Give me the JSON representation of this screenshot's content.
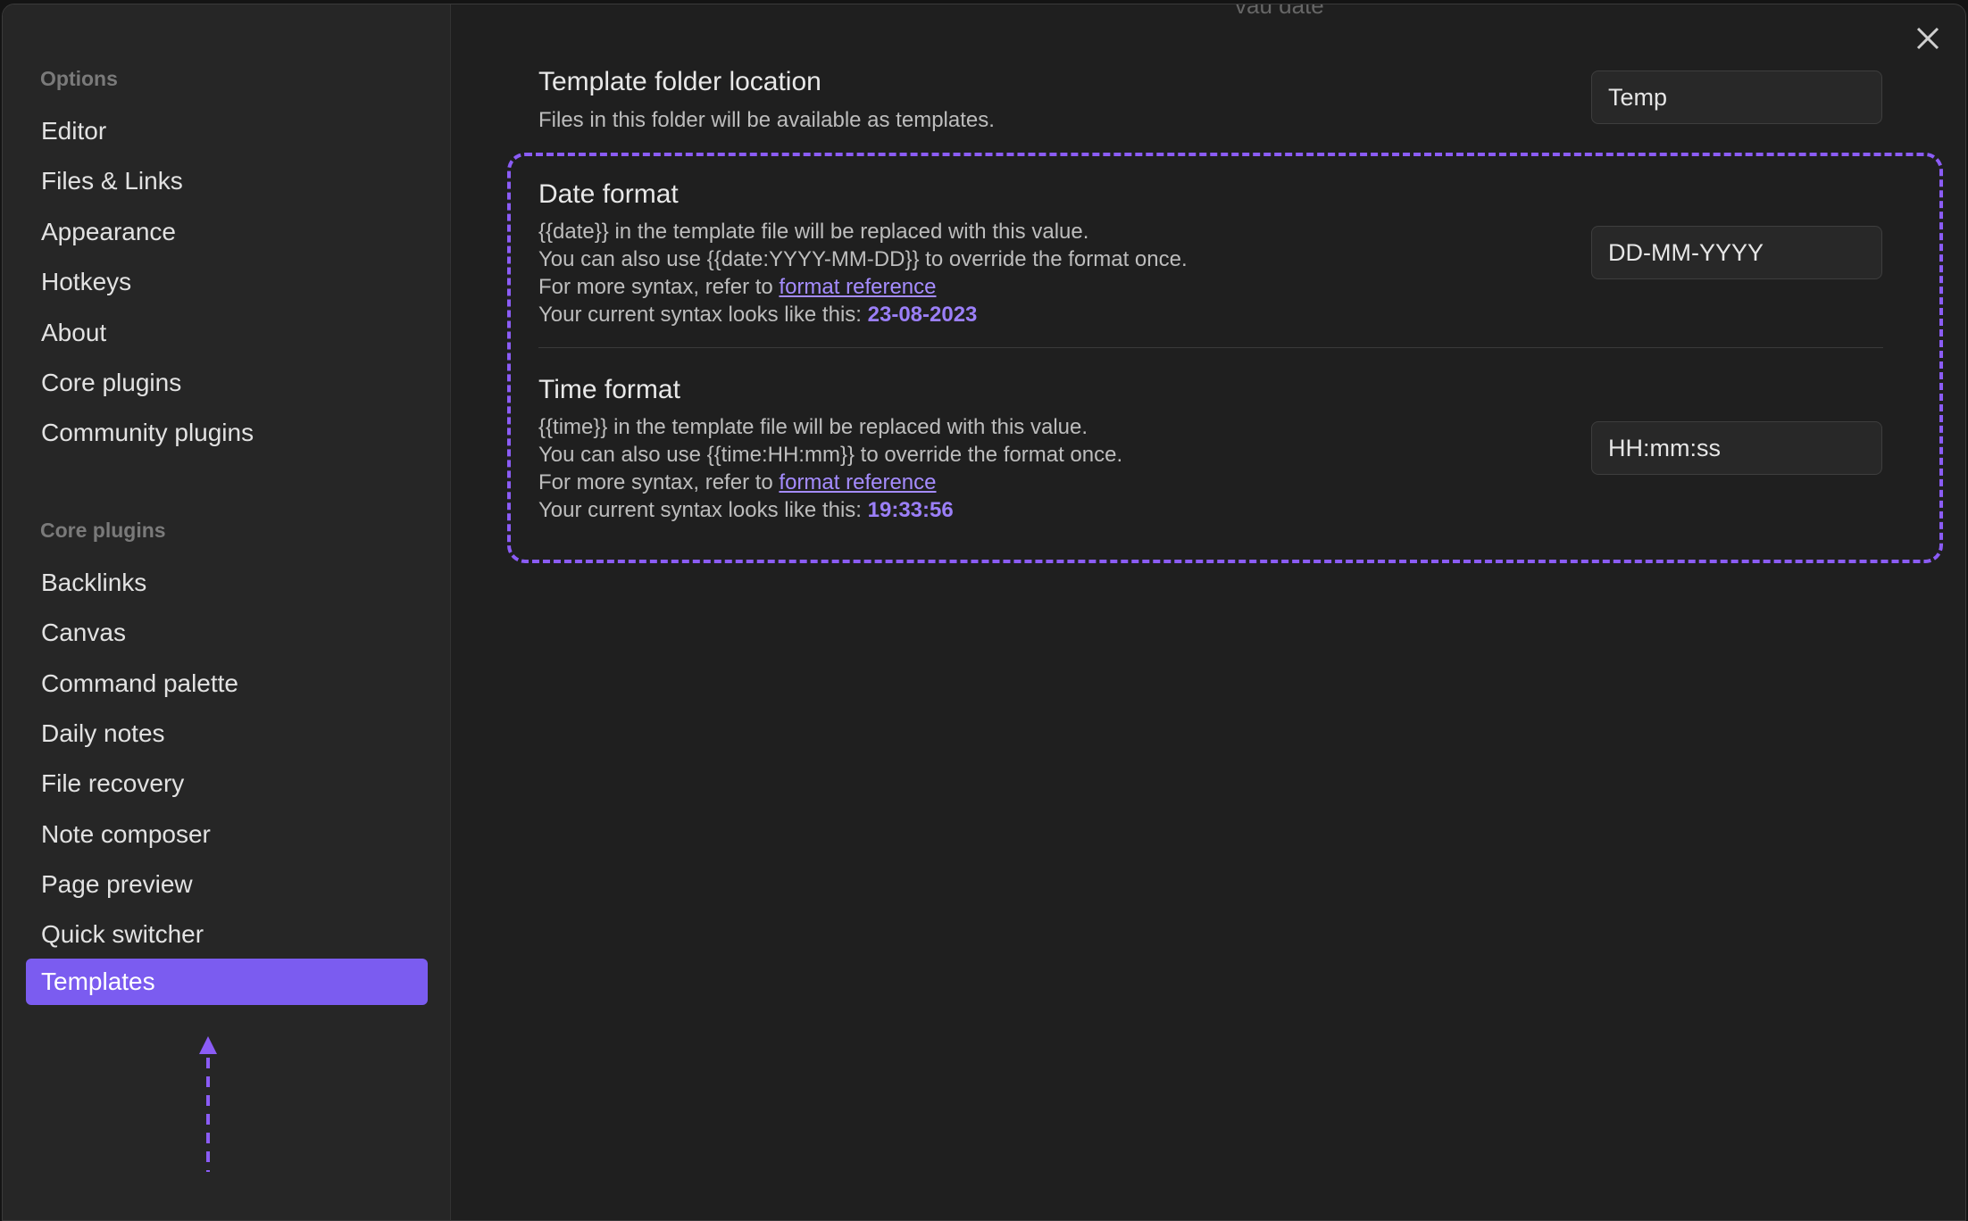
{
  "window": {
    "top_strip_text": "vau date"
  },
  "sidebar": {
    "options_heading": "Options",
    "options_items": [
      {
        "label": "Editor"
      },
      {
        "label": "Files & Links"
      },
      {
        "label": "Appearance"
      },
      {
        "label": "Hotkeys"
      },
      {
        "label": "About"
      },
      {
        "label": "Core plugins"
      },
      {
        "label": "Community plugins"
      }
    ],
    "core_heading": "Core plugins",
    "core_items": [
      {
        "label": "Backlinks"
      },
      {
        "label": "Canvas"
      },
      {
        "label": "Command palette"
      },
      {
        "label": "Daily notes"
      },
      {
        "label": "File recovery"
      },
      {
        "label": "Note composer"
      },
      {
        "label": "Page preview"
      },
      {
        "label": "Quick switcher"
      },
      {
        "label": "Templates",
        "active": true
      }
    ]
  },
  "main": {
    "close_icon": "close-icon",
    "template_folder": {
      "title": "Template folder location",
      "description": "Files in this folder will be available as templates.",
      "value": "Temp"
    },
    "date_format": {
      "title": "Date format",
      "line1": "{{date}} in the template file will be replaced with this value.",
      "line2": "You can also use {{date:YYYY-MM-DD}} to override the format once.",
      "line3_prefix": "For more syntax, refer to ",
      "link": "format reference",
      "line4_prefix": "Your current syntax looks like this: ",
      "sample": "23-08-2023",
      "value": "DD-MM-YYYY"
    },
    "time_format": {
      "title": "Time format",
      "line1": "{{time}} in the template file will be replaced with this value.",
      "line2": "You can also use {{time:HH:mm}} to override the format once.",
      "line3_prefix": "For more syntax, refer to ",
      "link": "format reference",
      "line4_prefix": "Your current syntax looks like this: ",
      "sample": "19:33:56",
      "value": "HH:mm:ss"
    }
  },
  "colors": {
    "accent": "#7b5cf0",
    "highlight_dash": "#8b5cf6",
    "background": "#1f1f1f",
    "sidebar": "#262626"
  }
}
